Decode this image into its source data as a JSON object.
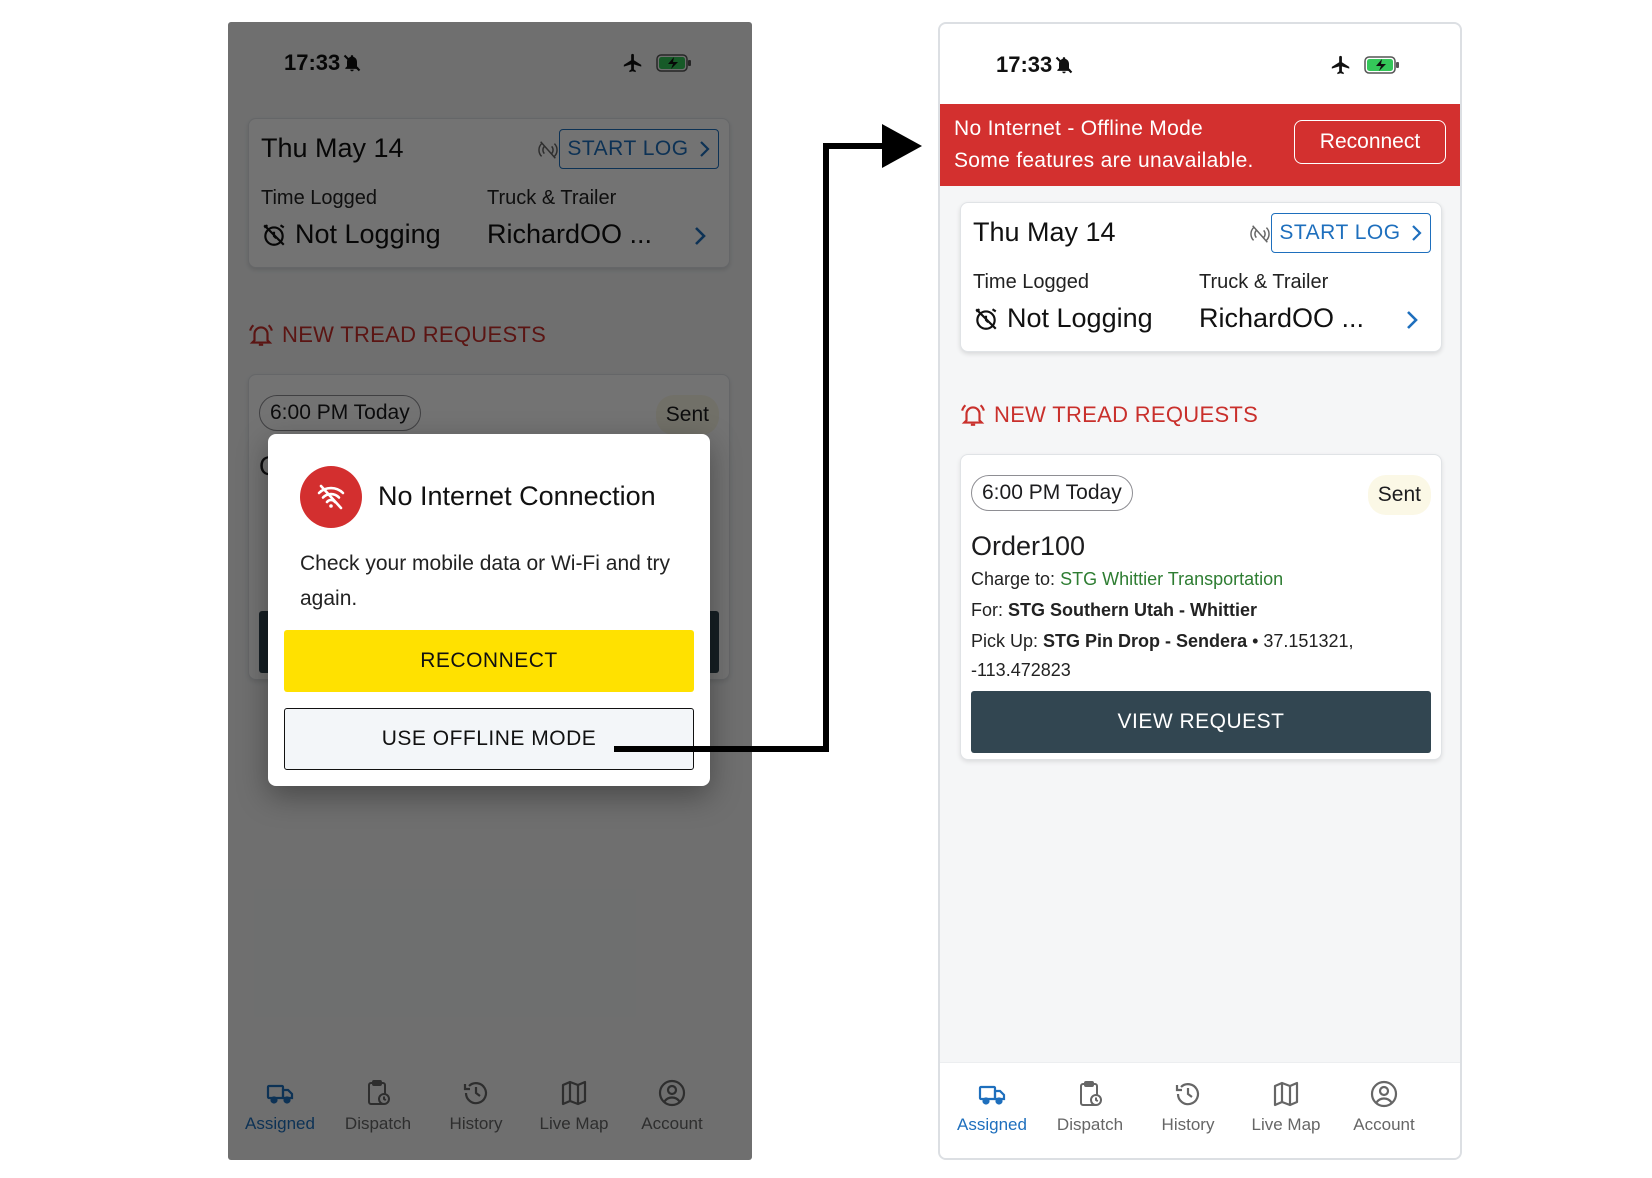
{
  "status_bar": {
    "time": "17:33"
  },
  "log_card": {
    "date": "Thu May 14",
    "start_log_label": "START LOG",
    "time_logged_label": "Time Logged",
    "time_logged_value": "Not Logging",
    "truck_trailer_label": "Truck & Trailer",
    "truck_trailer_value": "RichardOO ..."
  },
  "section_title": "NEW TREAD REQUESTS",
  "request": {
    "time_chip": "6:00 PM Today",
    "status": "Sent",
    "order": "Order100",
    "charge_label": "Charge to:",
    "charge_value": "STG Whittier Transportation",
    "for_label": "For:",
    "for_value": "STG Southern Utah - Whittier",
    "pickup_label": "Pick Up:",
    "pickup_value": "STG Pin Drop - Sendera",
    "pickup_coords_line1": "• 37.151321,",
    "pickup_coords_line2": "-113.472823",
    "view_button": "VIEW REQUEST"
  },
  "dialog": {
    "title": "No Internet Connection",
    "body": "Check your mobile data or Wi-Fi and try again.",
    "reconnect_label": "RECONNECT",
    "offline_label": "USE OFFLINE MODE"
  },
  "offline_banner": {
    "title": "No Internet - Offline Mode",
    "subtitle": "Some features are unavailable.",
    "button": "Reconnect"
  },
  "bottom_nav": {
    "assigned": "Assigned",
    "dispatch": "Dispatch",
    "history": "History",
    "live_map": "Live Map",
    "account": "Account",
    "active": "Assigned"
  },
  "colors": {
    "accent_blue": "#1e6fbd",
    "alert_red": "#d3302f",
    "reconnect_yellow": "#ffe100",
    "dark_button": "#324651",
    "link_green": "#2e7d32"
  },
  "icons": [
    "bell-off-icon",
    "airplane-icon",
    "battery-charging-icon",
    "no-signal-icon",
    "chevron-right-icon",
    "alarm-off-icon",
    "bell-ring-icon",
    "wifi-off-icon",
    "truck-icon",
    "clipboard-clock-icon",
    "history-icon",
    "map-icon",
    "account-icon"
  ]
}
